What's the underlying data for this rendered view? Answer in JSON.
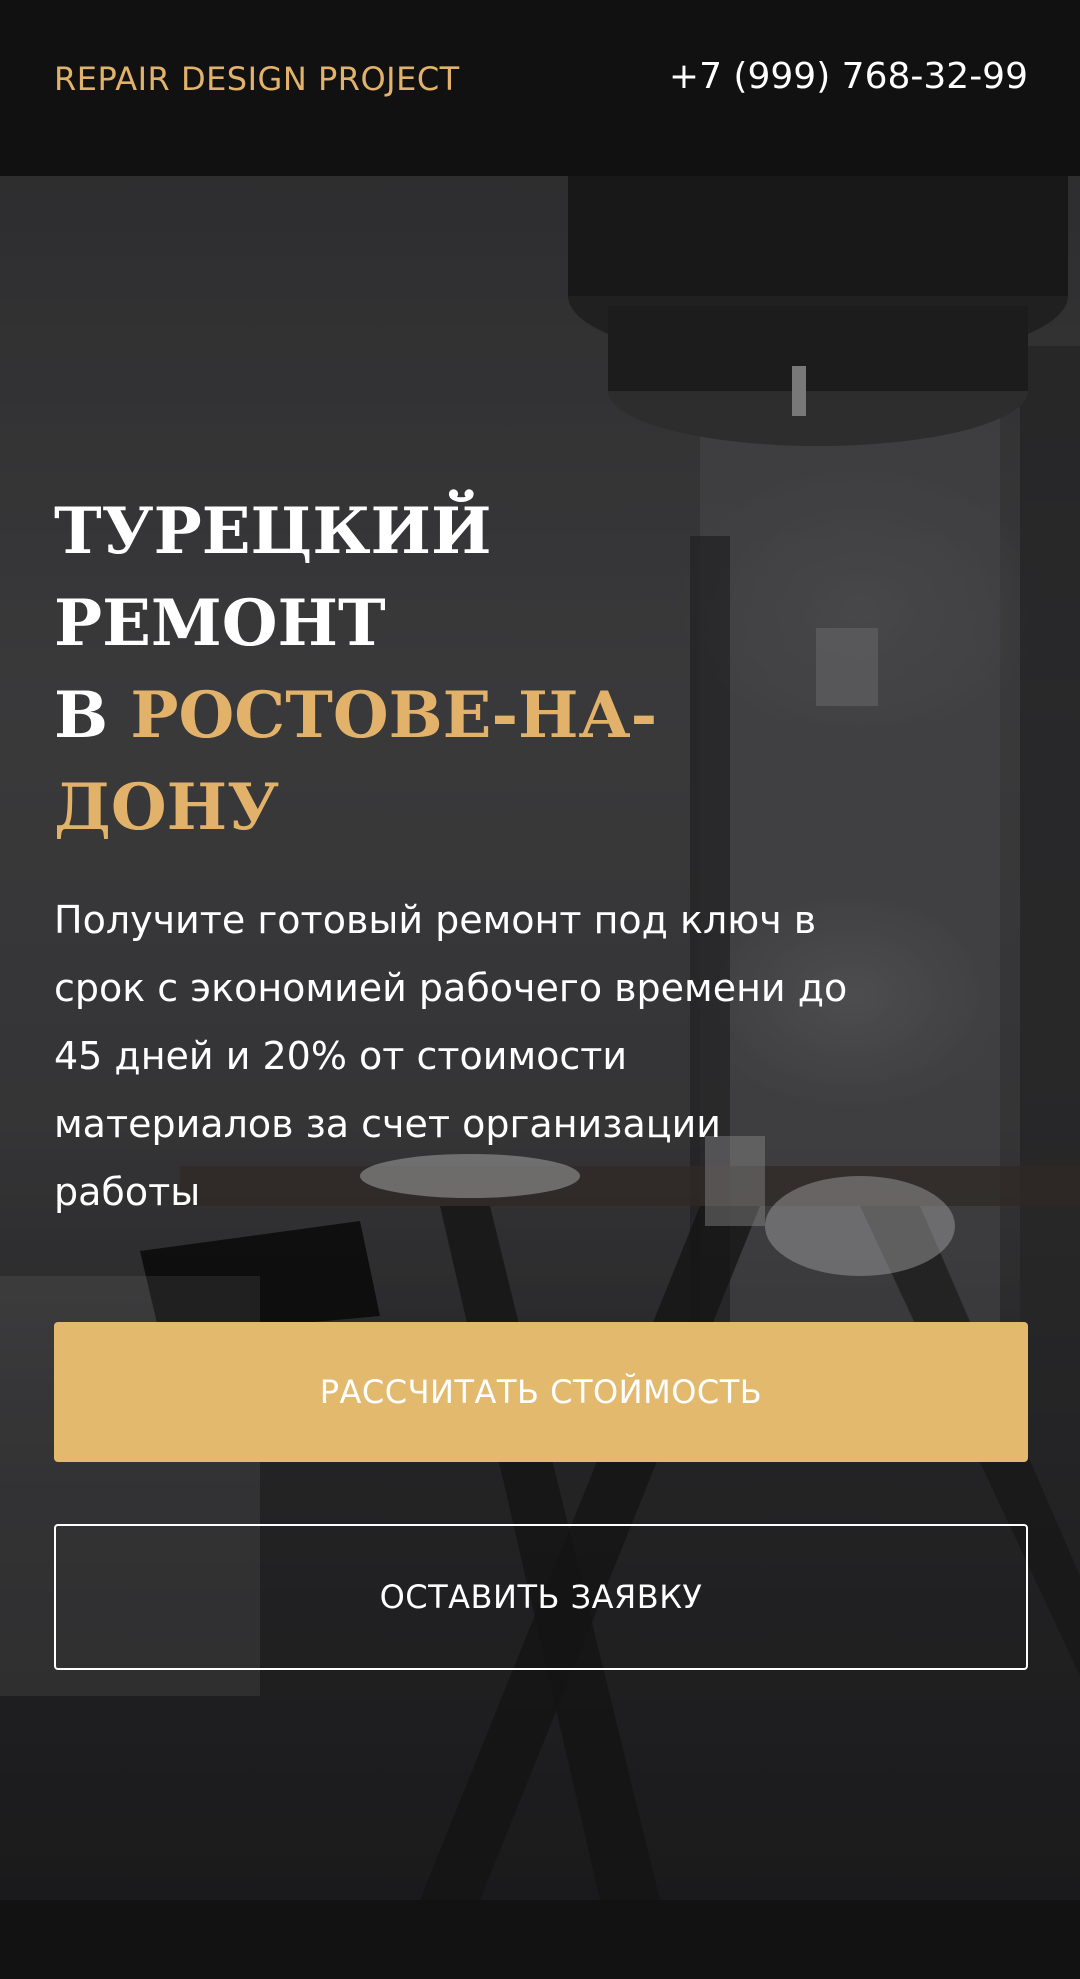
{
  "header": {
    "logo": "REPAIR DESIGN PROJECT",
    "phone": "+7 (999) 768-32-99"
  },
  "hero": {
    "title_line1": "ТУРЕЦКИЙ",
    "title_line2": "РЕМОНТ",
    "title_prefix": "В ",
    "title_accent_1": "РОСТОВЕ-НА-",
    "title_accent_2": "ДОНУ",
    "description": "Получите готовый ремонт под ключ в срок с экономией рабочего времени до 45 дней и 20% от стоимости материалов за счет организации работы",
    "primary_button": "РАССЧИТАТЬ СТОЙМОСТЬ",
    "secondary_button": "ОСТАВИТЬ ЗАЯВКУ",
    "background_image": "interior-photo"
  },
  "colors": {
    "accent": "#e3b26a",
    "button": "#e3b96e",
    "header_bg": "#111111",
    "text": "#ffffff"
  }
}
